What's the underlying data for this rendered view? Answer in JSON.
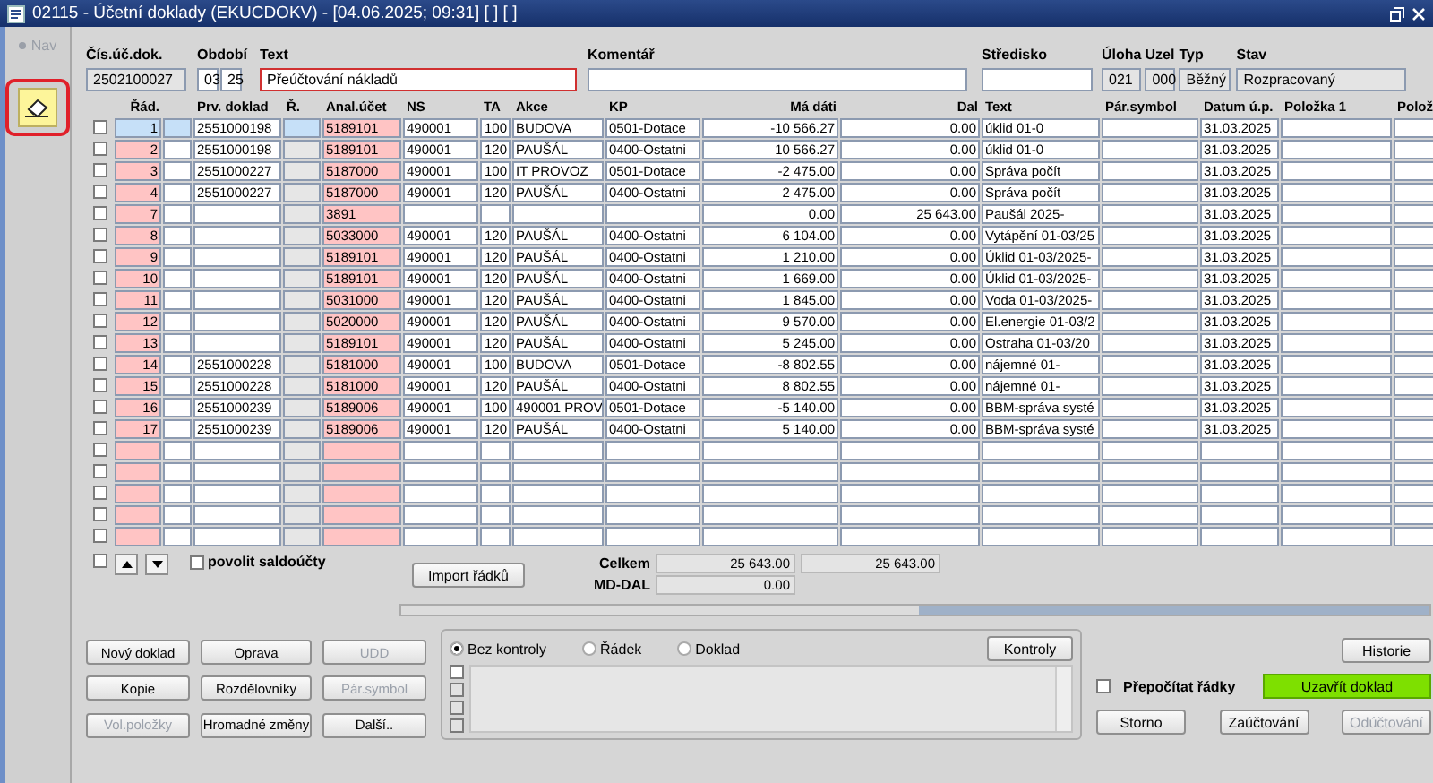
{
  "window": {
    "title": "02115 - Účetní doklady (EKUCDOKV) - [04.06.2025; 09:31] [ ] [ ]"
  },
  "nav": {
    "label": "Nav",
    "disabled": true
  },
  "header_fields": [
    {
      "label": "Čís.úč.dok.",
      "kind": "readonly",
      "values": [
        "2502100027"
      ]
    },
    {
      "label": "Období",
      "kind": "input",
      "values": [
        "03",
        "25"
      ]
    },
    {
      "label": "Text",
      "kind": "required",
      "values": [
        "Přeúčtování nákladů"
      ]
    },
    {
      "label": "Komentář",
      "kind": "input"
    },
    {
      "label": "Středisko",
      "kind": "input"
    },
    {
      "label": "Úloha",
      "kind": "readonly",
      "values": [
        "021"
      ]
    },
    {
      "label": "Uzel",
      "kind": "readonly",
      "values": [
        "000"
      ]
    },
    {
      "label": "Typ",
      "kind": "readonly",
      "values": [
        "Běžný"
      ]
    },
    {
      "label": "Stav",
      "kind": "readonly",
      "values": [
        "Rozpracovaný"
      ]
    }
  ],
  "table": {
    "columns": [
      "Řád.",
      "Prv. doklad",
      "Ř.",
      "Anal.účet",
      "NS",
      "TA",
      "Akce",
      "KP",
      "Má dáti",
      "Dal",
      "Text",
      "Pár.symbol",
      "Datum ú.p.",
      "Položka 1",
      "Polož"
    ],
    "rows": [
      {
        "selected": true,
        "checked": false,
        "rad": "1",
        "prv_doklad": "2551000198",
        "anal_ucet": "5189101",
        "ns": "490001",
        "ta": "100",
        "akce": "BUDOVA",
        "kp": "0501-Dotace",
        "ma_dati": "-10 566.27",
        "dal": "0.00",
        "text": "úklid 01-0",
        "datum": "31.03.2025"
      },
      {
        "selected": false,
        "checked": false,
        "rad": "2",
        "prv_doklad": "2551000198",
        "anal_ucet": "5189101",
        "ns": "490001",
        "ta": "120",
        "akce": "PAUŠÁL",
        "kp": "0400-Ostatni",
        "ma_dati": "10 566.27",
        "dal": "0.00",
        "text": "úklid 01-0",
        "datum": "31.03.2025"
      },
      {
        "selected": false,
        "checked": false,
        "rad": "3",
        "prv_doklad": "2551000227",
        "anal_ucet": "5187000",
        "ns": "490001",
        "ta": "100",
        "akce": "IT PROVOZ",
        "kp": "0501-Dotace",
        "ma_dati": "-2 475.00",
        "dal": "0.00",
        "text": "Správa počít",
        "datum": "31.03.2025"
      },
      {
        "selected": false,
        "checked": false,
        "rad": "4",
        "prv_doklad": "2551000227",
        "anal_ucet": "5187000",
        "ns": "490001",
        "ta": "120",
        "akce": "PAUŠÁL",
        "kp": "0400-Ostatni",
        "ma_dati": "2 475.00",
        "dal": "0.00",
        "text": "Správa počít",
        "datum": "31.03.2025"
      },
      {
        "selected": false,
        "checked": false,
        "rad": "7",
        "anal_ucet": "3891",
        "ma_dati": "0.00",
        "dal": "25 643.00",
        "text": "Paušál 2025-",
        "datum": "31.03.2025"
      },
      {
        "selected": false,
        "checked": false,
        "rad": "8",
        "anal_ucet": "5033000",
        "ns": "490001",
        "ta": "120",
        "akce": "PAUŠÁL",
        "kp": "0400-Ostatni",
        "ma_dati": "6 104.00",
        "dal": "0.00",
        "text": "Vytápění 01-03/25",
        "datum": "31.03.2025"
      },
      {
        "selected": false,
        "checked": false,
        "rad": "9",
        "anal_ucet": "5189101",
        "ns": "490001",
        "ta": "120",
        "akce": "PAUŠÁL",
        "kp": "0400-Ostatni",
        "ma_dati": "1 210.00",
        "dal": "0.00",
        "text": "Úklid 01-03/2025-",
        "datum": "31.03.2025"
      },
      {
        "selected": false,
        "checked": false,
        "rad": "10",
        "anal_ucet": "5189101",
        "ns": "490001",
        "ta": "120",
        "akce": "PAUŠÁL",
        "kp": "0400-Ostatni",
        "ma_dati": "1 669.00",
        "dal": "0.00",
        "text": "Úklid 01-03/2025-",
        "datum": "31.03.2025"
      },
      {
        "selected": false,
        "checked": false,
        "rad": "11",
        "anal_ucet": "5031000",
        "ns": "490001",
        "ta": "120",
        "akce": "PAUŠÁL",
        "kp": "0400-Ostatni",
        "ma_dati": "1 845.00",
        "dal": "0.00",
        "text": "Voda 01-03/2025-",
        "datum": "31.03.2025"
      },
      {
        "selected": false,
        "checked": false,
        "rad": "12",
        "anal_ucet": "5020000",
        "ns": "490001",
        "ta": "120",
        "akce": "PAUŠÁL",
        "kp": "0400-Ostatni",
        "ma_dati": "9 570.00",
        "dal": "0.00",
        "text": "El.energie 01-03/2",
        "datum": "31.03.2025"
      },
      {
        "selected": false,
        "checked": false,
        "rad": "13",
        "anal_ucet": "5189101",
        "ns": "490001",
        "ta": "120",
        "akce": "PAUŠÁL",
        "kp": "0400-Ostatni",
        "ma_dati": "5 245.00",
        "dal": "0.00",
        "text": "Ostraha 01-03/20",
        "datum": "31.03.2025"
      },
      {
        "selected": false,
        "checked": false,
        "rad": "14",
        "prv_doklad": "2551000228",
        "anal_ucet": "5181000",
        "ns": "490001",
        "ta": "100",
        "akce": "BUDOVA",
        "kp": "0501-Dotace",
        "ma_dati": "-8 802.55",
        "dal": "0.00",
        "text": "nájemné 01-",
        "datum": "31.03.2025"
      },
      {
        "selected": false,
        "checked": false,
        "rad": "15",
        "prv_doklad": "2551000228",
        "anal_ucet": "5181000",
        "ns": "490001",
        "ta": "120",
        "akce": "PAUŠÁL",
        "kp": "0400-Ostatni",
        "ma_dati": "8 802.55",
        "dal": "0.00",
        "text": "nájemné 01-",
        "datum": "31.03.2025"
      },
      {
        "selected": false,
        "checked": false,
        "rad": "16",
        "prv_doklad": "2551000239",
        "anal_ucet": "5189006",
        "ns": "490001",
        "ta": "100",
        "akce": "490001 PROV",
        "kp": "0501-Dotace",
        "ma_dati": "-5 140.00",
        "dal": "0.00",
        "text": "BBM-správa systé",
        "datum": "31.03.2025"
      },
      {
        "selected": false,
        "checked": false,
        "rad": "17",
        "prv_doklad": "2551000239",
        "anal_ucet": "5189006",
        "ns": "490001",
        "ta": "120",
        "akce": "PAUŠÁL",
        "kp": "0400-Ostatni",
        "ma_dati": "5 140.00",
        "dal": "0.00",
        "text": "BBM-správa systé",
        "datum": "31.03.2025"
      }
    ]
  },
  "empty_rows": [
    {
      "checked": false
    },
    {
      "checked": false
    },
    {
      "checked": false
    },
    {
      "checked": false
    },
    {
      "checked": false
    }
  ],
  "table_footer": {
    "select_all": {
      "checked": false
    },
    "saldo": {
      "label": "povolit saldoúčty",
      "checked": false
    },
    "import_button": "Import řádků",
    "total_label": "Celkem",
    "total_ma_dati": "25 643.00",
    "total_dal": "25 643.00",
    "difference_label": "MD-DAL",
    "difference": "0.00"
  },
  "action_buttons": [
    {
      "label": "Nový doklad",
      "disabled": false
    },
    {
      "label": "Oprava",
      "disabled": false
    },
    {
      "label": "UDD",
      "disabled": true
    },
    {
      "label": "Kopie",
      "disabled": false
    },
    {
      "label": "Rozdělovníky",
      "disabled": false
    },
    {
      "label": "Pár.symbol",
      "disabled": true
    },
    {
      "label": "Vol.položky",
      "disabled": true
    },
    {
      "label": "Hromadné změny",
      "disabled": false
    },
    {
      "label": "Další..",
      "disabled": false
    }
  ],
  "control_panel": {
    "radios": [
      {
        "label": "Bez kontroly",
        "selected": true
      },
      {
        "label": "Řádek",
        "selected": false
      },
      {
        "label": "Doklad",
        "selected": false
      }
    ],
    "button": "Kontroly",
    "checklist": [
      {
        "checked": false,
        "disabled": false
      },
      {
        "checked": false,
        "disabled": true
      },
      {
        "checked": false,
        "disabled": true
      },
      {
        "checked": false,
        "disabled": true
      }
    ]
  },
  "right_panel": {
    "history_button": "Historie",
    "recalc": {
      "label": "Přepočítat řádky",
      "checked": false
    },
    "close_button": "Uzavřít doklad",
    "buttons": [
      {
        "label": "Storno",
        "disabled": false
      },
      {
        "label": "Zaúčtování",
        "disabled": false
      },
      {
        "label": "Odúčtování",
        "disabled": true
      }
    ]
  }
}
